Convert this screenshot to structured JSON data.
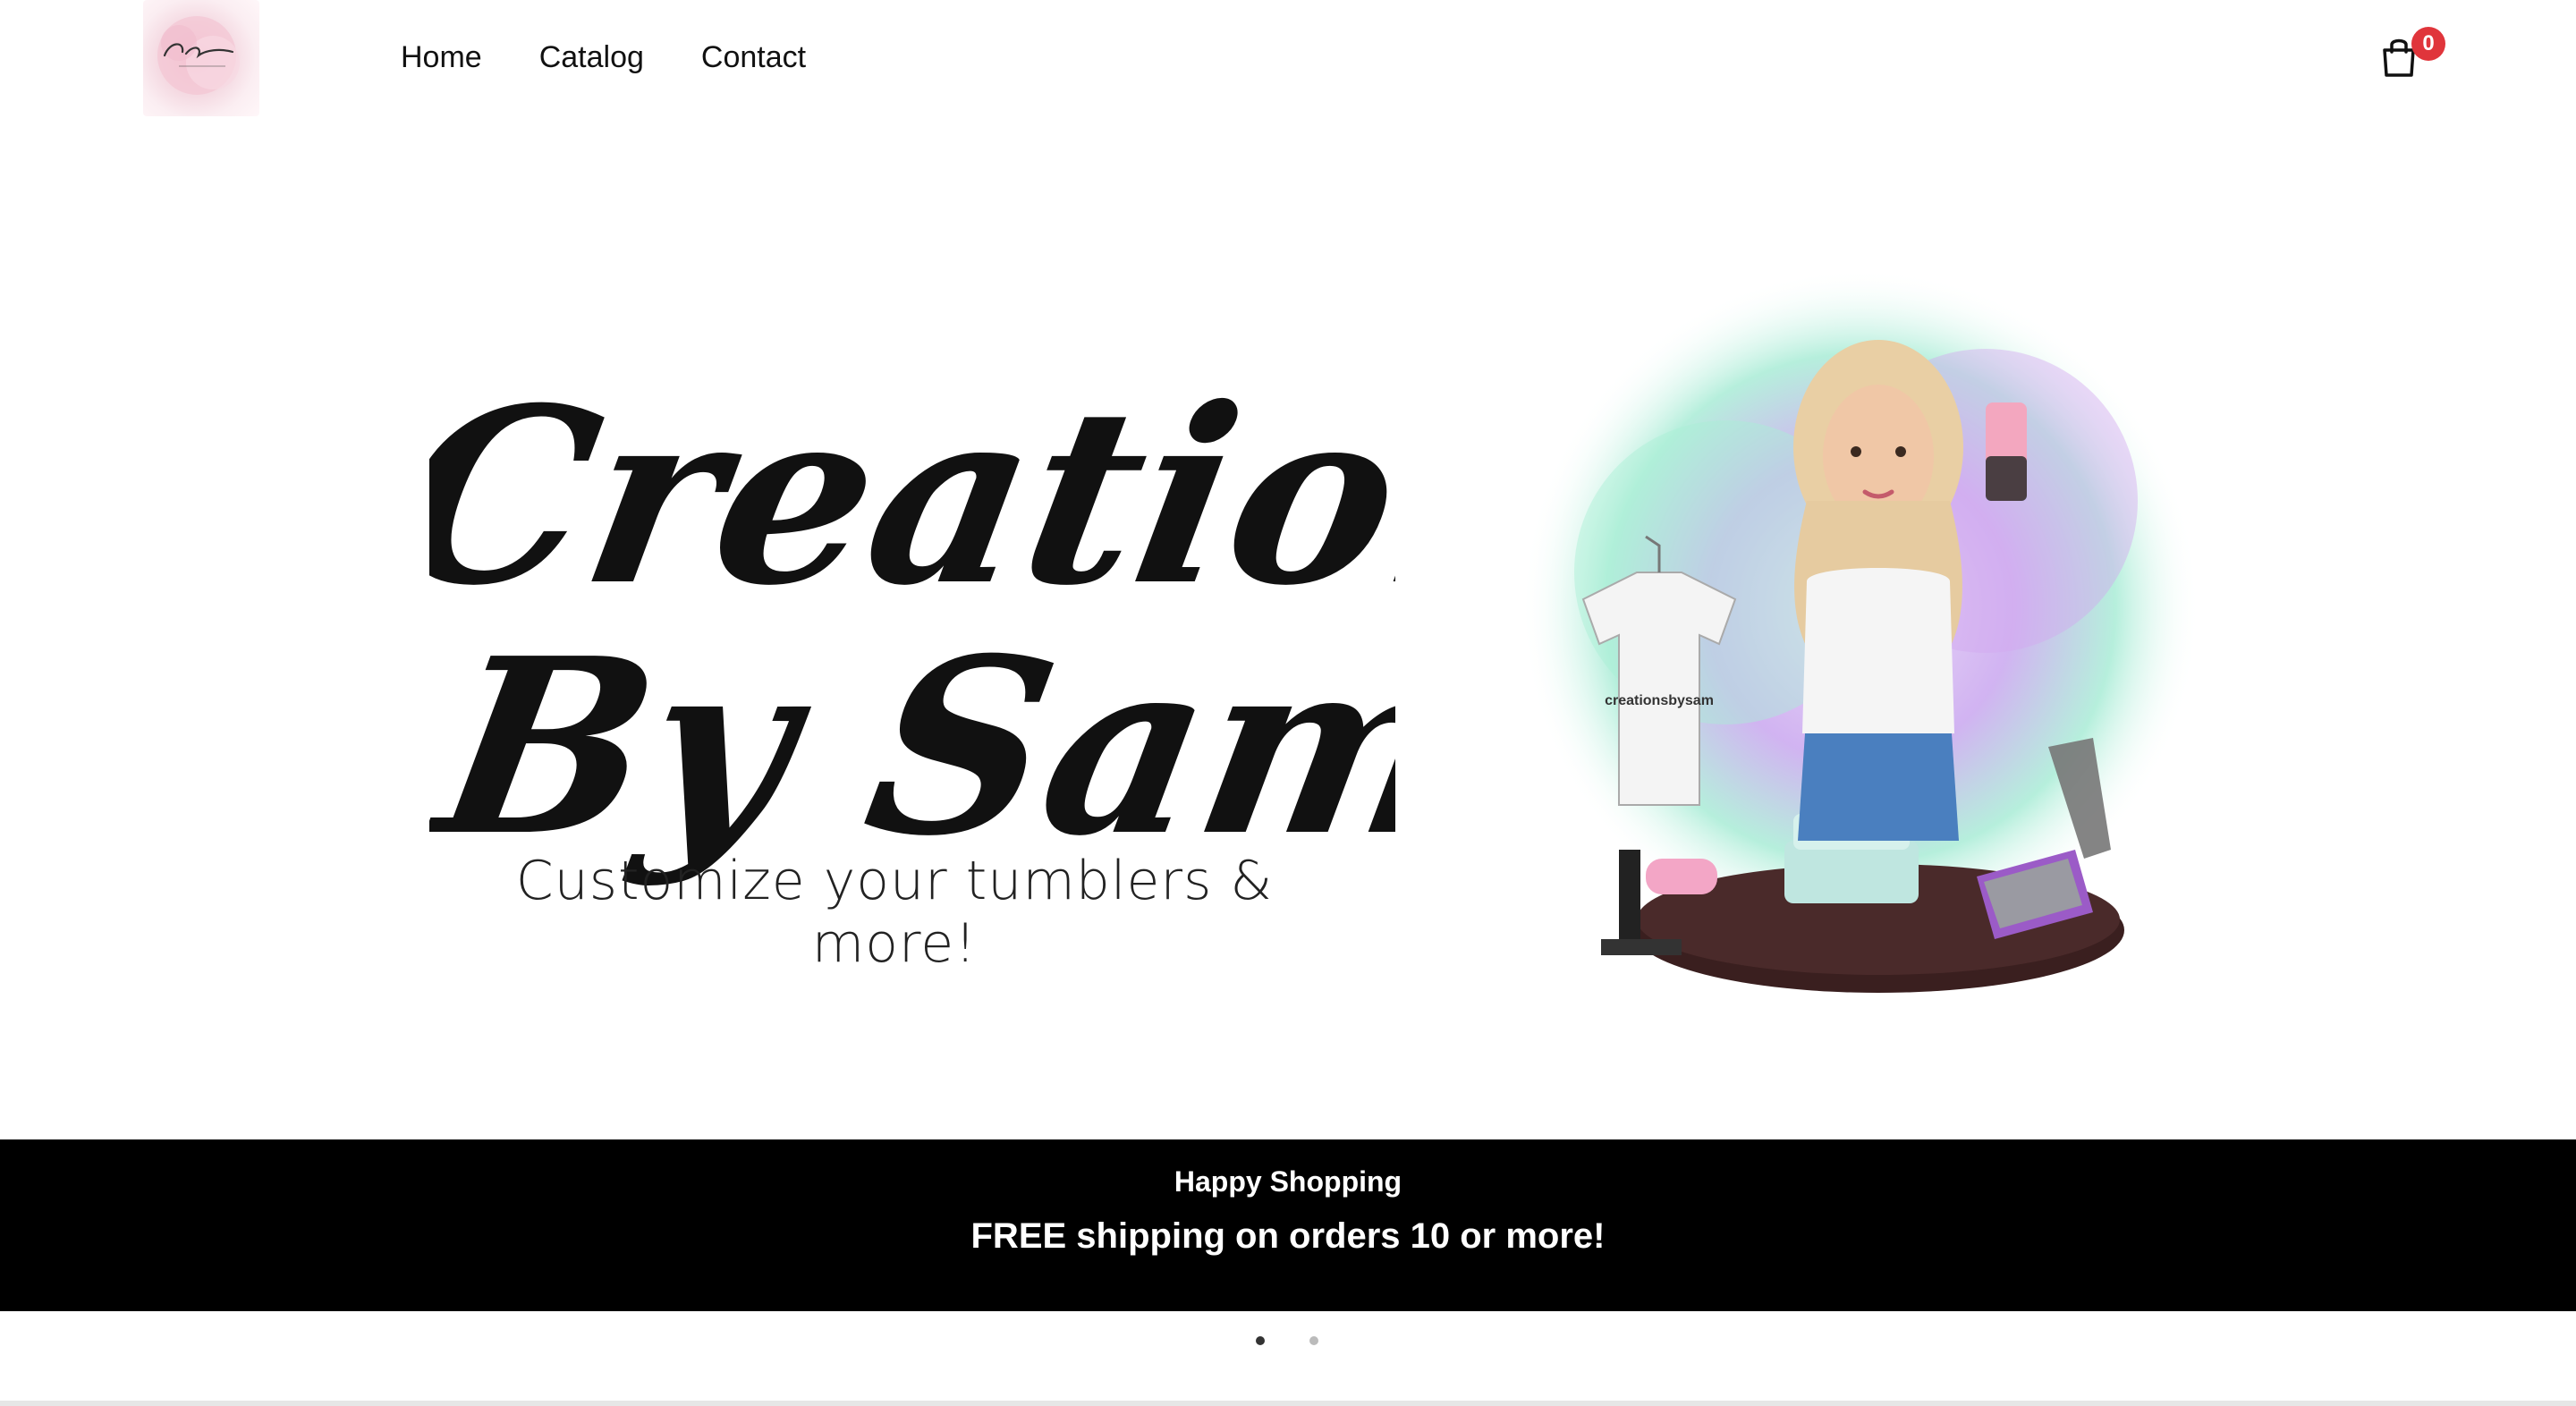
{
  "header": {
    "logo_alt": "Creations by Sam",
    "nav": [
      {
        "label": "Home"
      },
      {
        "label": "Catalog"
      },
      {
        "label": "Contact"
      }
    ],
    "cart": {
      "icon": "shopping-bag-icon",
      "count": "0"
    }
  },
  "hero": {
    "wordmark_line1": "Creations",
    "wordmark_line2": "By Sam",
    "tagline": "Customize your tumblers & more!",
    "shirt_text": "creationsbysam"
  },
  "banner": {
    "title": "Happy Shopping",
    "subtitle": "FREE shipping on orders 10 or more!"
  },
  "slideshow": {
    "active_index": 1,
    "total": 2
  },
  "colors": {
    "badge": "#e0353b",
    "banner_bg": "#000000",
    "banner_text": "#ffffff"
  }
}
